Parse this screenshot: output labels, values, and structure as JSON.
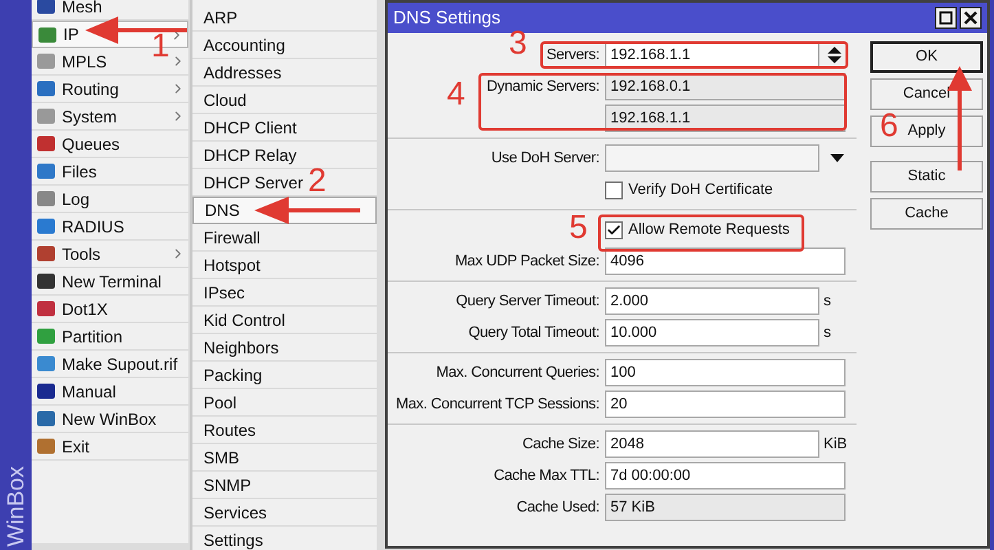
{
  "side_label": "WinBox",
  "menu": [
    {
      "label": "Mesh",
      "submenu": false,
      "selected": false
    },
    {
      "label": "IP",
      "submenu": true,
      "selected": true
    },
    {
      "label": "MPLS",
      "submenu": true,
      "selected": false
    },
    {
      "label": "Routing",
      "submenu": true,
      "selected": false
    },
    {
      "label": "System",
      "submenu": true,
      "selected": false
    },
    {
      "label": "Queues",
      "submenu": false,
      "selected": false
    },
    {
      "label": "Files",
      "submenu": false,
      "selected": false
    },
    {
      "label": "Log",
      "submenu": false,
      "selected": false
    },
    {
      "label": "RADIUS",
      "submenu": false,
      "selected": false
    },
    {
      "label": "Tools",
      "submenu": true,
      "selected": false
    },
    {
      "label": "New Terminal",
      "submenu": false,
      "selected": false
    },
    {
      "label": "Dot1X",
      "submenu": false,
      "selected": false
    },
    {
      "label": "Partition",
      "submenu": false,
      "selected": false
    },
    {
      "label": "Make Supout.rif",
      "submenu": false,
      "selected": false
    },
    {
      "label": "Manual",
      "submenu": false,
      "selected": false
    },
    {
      "label": "New WinBox",
      "submenu": false,
      "selected": false
    },
    {
      "label": "Exit",
      "submenu": false,
      "selected": false
    }
  ],
  "submenu": [
    {
      "label": "ARP",
      "selected": false
    },
    {
      "label": "Accounting",
      "selected": false
    },
    {
      "label": "Addresses",
      "selected": false
    },
    {
      "label": "Cloud",
      "selected": false
    },
    {
      "label": "DHCP Client",
      "selected": false
    },
    {
      "label": "DHCP Relay",
      "selected": false
    },
    {
      "label": "DHCP Server",
      "selected": false
    },
    {
      "label": "DNS",
      "selected": true
    },
    {
      "label": "Firewall",
      "selected": false
    },
    {
      "label": "Hotspot",
      "selected": false
    },
    {
      "label": "IPsec",
      "selected": false
    },
    {
      "label": "Kid Control",
      "selected": false
    },
    {
      "label": "Neighbors",
      "selected": false
    },
    {
      "label": "Packing",
      "selected": false
    },
    {
      "label": "Pool",
      "selected": false
    },
    {
      "label": "Routes",
      "selected": false
    },
    {
      "label": "SMB",
      "selected": false
    },
    {
      "label": "SNMP",
      "selected": false
    },
    {
      "label": "Services",
      "selected": false
    },
    {
      "label": "Settings",
      "selected": false
    }
  ],
  "dialog": {
    "title": "DNS Settings",
    "fields": [
      {
        "kind": "spinner",
        "label": "Servers:",
        "value": "192.168.1.1"
      },
      {
        "kind": "readonly",
        "label": "Dynamic Servers:",
        "value": "192.168.0.1"
      },
      {
        "kind": "readonly",
        "value": "192.168.1.1"
      },
      {
        "kind": "separator"
      },
      {
        "kind": "combo",
        "label": "Use DoH Server:"
      },
      {
        "kind": "checkbox",
        "label": "Verify DoH Certificate",
        "checked": false
      },
      {
        "kind": "separator"
      },
      {
        "kind": "checkbox",
        "label": "Allow Remote Requests",
        "checked": true
      },
      {
        "kind": "input",
        "label": "Max UDP Packet Size:",
        "value": "4096"
      },
      {
        "kind": "separator"
      },
      {
        "kind": "input",
        "label": "Query Server Timeout:",
        "value": "2.000",
        "unit": "s"
      },
      {
        "kind": "input",
        "label": "Query Total Timeout:",
        "value": "10.000",
        "unit": "s"
      },
      {
        "kind": "separator"
      },
      {
        "kind": "input",
        "label": "Max. Concurrent Queries:",
        "value": "100"
      },
      {
        "kind": "input",
        "label": "Max. Concurrent TCP Sessions:",
        "value": "20"
      },
      {
        "kind": "separator"
      },
      {
        "kind": "input",
        "label": "Cache Size:",
        "value": "2048",
        "unit": "KiB"
      },
      {
        "kind": "input",
        "label": "Cache Max TTL:",
        "value": "7d 00:00:00"
      },
      {
        "kind": "readonly",
        "label": "Cache Used:",
        "value": "57 KiB"
      }
    ],
    "buttons": [
      {
        "label": "OK",
        "selected": true
      },
      {
        "label": "Cancel",
        "selected": false
      },
      {
        "label": "Apply",
        "selected": false
      },
      {
        "label": "Static",
        "selected": false
      },
      {
        "label": "Cache",
        "selected": false
      }
    ]
  },
  "annotations": [
    "1",
    "2",
    "3",
    "4",
    "5",
    "6"
  ]
}
